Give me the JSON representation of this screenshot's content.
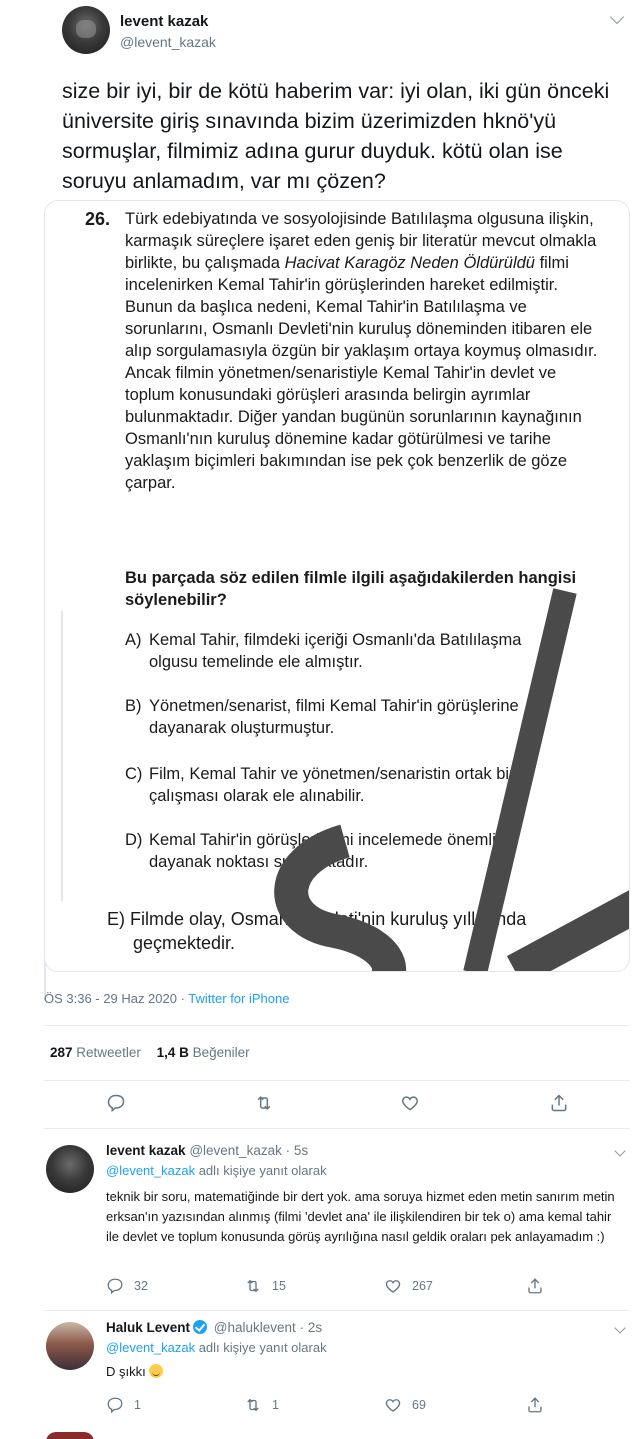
{
  "tweet": {
    "name": "levent kazak",
    "handle": "@levent_kazak",
    "text": "size bir iyi, bir de kötü haberim var: iyi olan, iki gün önceki üniversite giriş sınavında bizim üzerimizden hknö'yü sormuşlar, filmimiz adına gurur duyduk. kötü olan ise soruyu anlamadım, var mı çözen?",
    "meta_time": "ÖS 3:36 - 29 Haz 2020 · ",
    "meta_source": "Twitter for iPhone",
    "retweets_count": "287",
    "retweets_label": "Retweetler",
    "likes_count": "1,4 B",
    "likes_label": "Beğeniler"
  },
  "exam": {
    "number": "26.",
    "body_1": "Türk edebiyatında ve sosyolojisinde Batılılaşma olgusuna ilişkin, karmaşık süreçlere işaret eden geniş bir literatür mevcut olmakla birlikte, bu çalışmada",
    "film_title": "Hacivat Karagöz Neden Öldürüldü",
    "body_2": "filmi incelenirken Kemal Tahir'in görüşlerinden hareket edilmiştir. Bunun da başlıca nedeni, Kemal Tahir'in Batılılaşma ve sorunlarını, Osmanlı Devleti'nin kuruluş döneminden itibaren ele alıp sorgulamasıyla özgün bir yaklaşım ortaya koymuş olmasıdır. Ancak filmin yönetmen/senaristiyle Kemal Tahir'in devlet ve toplum konusundaki görüşleri arasında belirgin ayrımlar bulunmaktadır. Diğer yandan bugünün sorunlarının kaynağının Osmanlı'nın kuruluş dönemine kadar götürülmesi ve tarihe yaklaşım biçimleri bakımından ise pek çok benzerlik de göze çarpar.",
    "question": "Bu parçada söz edilen filmle ilgili aşağıdakilerden hangisi söylenebilir?",
    "options": [
      {
        "letter": "A)",
        "line1": "Kemal Tahir, filmdeki içeriği Osmanlı'da Batılılaşma",
        "line2": "olgusu temelinde ele almıştır."
      },
      {
        "letter": "B)",
        "line1": "Yönetmen/senarist, filmi Kemal Tahir'in görüşlerine",
        "line2": "dayanarak oluşturmuştur."
      },
      {
        "letter": "C)",
        "line1": "Film, Kemal Tahir ve yönetmen/senaristin ortak bir",
        "line2": "çalışması olarak ele alınabilir."
      },
      {
        "letter": "D)",
        "line1": "Kemal Tahir'in görüşleri filmi incelemede önemli bir",
        "line2": "dayanak noktası sunmaktadır."
      },
      {
        "letter": "E)",
        "line1": "Filmde olay, Osmanlı Devleti'nin kuruluş yıllarında",
        "line2": "geçmektedir."
      }
    ]
  },
  "replies": [
    {
      "name": "levent kazak",
      "handle": "@levent_kazak",
      "time": "· 5s",
      "replying_mention": "@levent_kazak",
      "replying_text": " adlı kişiye yanıt olarak",
      "text": "teknik bir soru, matematiğinde bir dert yok. ama soruya hizmet eden metin sanırım metin erksan'ın yazısından alınmış (filmi 'devlet ana' ile ilişkilendiren bir tek o) ama kemal tahir ile devlet ve toplum konusunda görüş ayrılığına nasıl geldik oraları pek anlayamadım :)",
      "replies": "32",
      "retweets": "15",
      "likes": "267"
    },
    {
      "name": "Haluk Levent",
      "handle": "@haluklevent",
      "time": "· 2s",
      "replying_mention": "@levent_kazak",
      "replying_text": " adlı kişiye yanıt olarak",
      "text": "D şıkkı",
      "replies": "1",
      "retweets": "1",
      "likes": "69"
    }
  ],
  "colors": {
    "accent": "#1da1f2",
    "secondary_text": "#657786",
    "primary_text": "#14171a",
    "divider": "#e6ecf0"
  },
  "icons": [
    "reply-icon",
    "retweet-icon",
    "like-icon",
    "share-icon",
    "verified-badge-icon",
    "smile-emoji-icon",
    "chevron-down-icon"
  ]
}
